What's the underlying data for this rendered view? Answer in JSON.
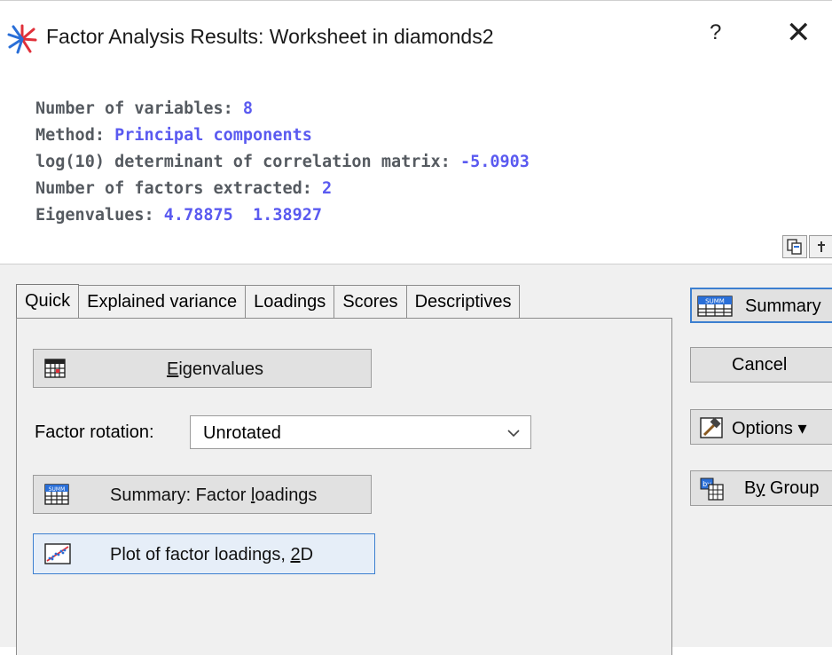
{
  "window": {
    "title": "Factor Analysis Results: Worksheet in diamonds2",
    "help_glyph": "?",
    "close_glyph": "✕"
  },
  "summary": {
    "variables_label": "Number of variables:",
    "variables_value": "8",
    "method_label": "Method:",
    "method_value": "Principal components",
    "determinant_label": "log(10) determinant of correlation matrix:",
    "determinant_value": "-5.0903",
    "factors_label": "Number of factors extracted:",
    "factors_value": "2",
    "eigen_label": "Eigenvalues:",
    "eigen_value_1": "4.78875",
    "eigen_value_2": "1.38927"
  },
  "tabs": [
    {
      "label": "Quick",
      "active": true
    },
    {
      "label": "Explained variance",
      "active": false
    },
    {
      "label": "Loadings",
      "active": false
    },
    {
      "label": "Scores",
      "active": false
    },
    {
      "label": "Descriptives",
      "active": false
    }
  ],
  "quick": {
    "eigenvalues_button_pre": "",
    "eigenvalues_button_ul": "E",
    "eigenvalues_button_post": "igenvalues",
    "factor_rotation_label": "Factor rotation:",
    "factor_rotation_value": "Unrotated",
    "summary_loadings_pre": "Summary: Factor ",
    "summary_loadings_ul": "l",
    "summary_loadings_post": "oadings",
    "plot_loadings_pre": "Plot of factor loadings, ",
    "plot_loadings_ul": "2",
    "plot_loadings_post": "D"
  },
  "side": {
    "summary_label": "Summary",
    "cancel_label": "Cancel",
    "options_label": "Options",
    "options_arrow": "▾",
    "bygroup_pre": "B",
    "bygroup_ul": "y",
    "bygroup_post": " Group"
  },
  "colors": {
    "value_text": "#5a5af0",
    "label_text": "#555a60",
    "dialog_bg": "#f0f0f0"
  }
}
